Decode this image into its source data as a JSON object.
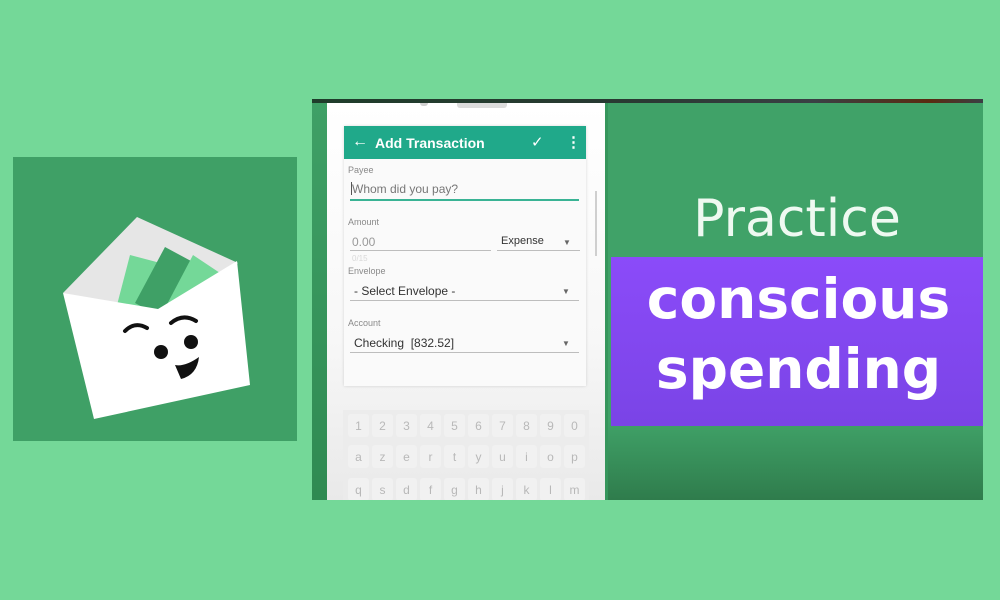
{
  "colors": {
    "background": "#74D898",
    "icon_bg": "#3FA066",
    "toolbar": "#20A98A",
    "banner": "#8B4BF9",
    "panel": "#40A268"
  },
  "app_icon": {
    "name": "envelope-mascot-logo"
  },
  "phone": {
    "toolbar": {
      "back_icon": "←",
      "title": "Add Transaction",
      "check_icon": "✓",
      "more_icon": "⋮"
    },
    "form": {
      "payee": {
        "label": "Payee",
        "placeholder": "Whom did you pay?"
      },
      "amount": {
        "label": "Amount",
        "value": "0.00",
        "counter": "0/15",
        "type_value": "Expense",
        "dropdown_icon": "▼"
      },
      "envelope": {
        "label": "Envelope",
        "value": "- Select Envelope -",
        "dropdown_icon": "▼"
      },
      "account": {
        "label": "Account",
        "value": "Checking  [832.52]",
        "dropdown_icon": "▼"
      }
    },
    "keyboard": {
      "rows": [
        [
          "1",
          "2",
          "3",
          "4",
          "5",
          "6",
          "7",
          "8",
          "9",
          "0"
        ],
        [
          "a",
          "z",
          "e",
          "r",
          "t",
          "y",
          "u",
          "i",
          "o",
          "p"
        ],
        [
          "q",
          "s",
          "d",
          "f",
          "g",
          "h",
          "j",
          "k",
          "l",
          "m"
        ]
      ]
    }
  },
  "promo": {
    "line_top": "Practice",
    "banner_line1": "conscious",
    "banner_line2": "spending"
  }
}
